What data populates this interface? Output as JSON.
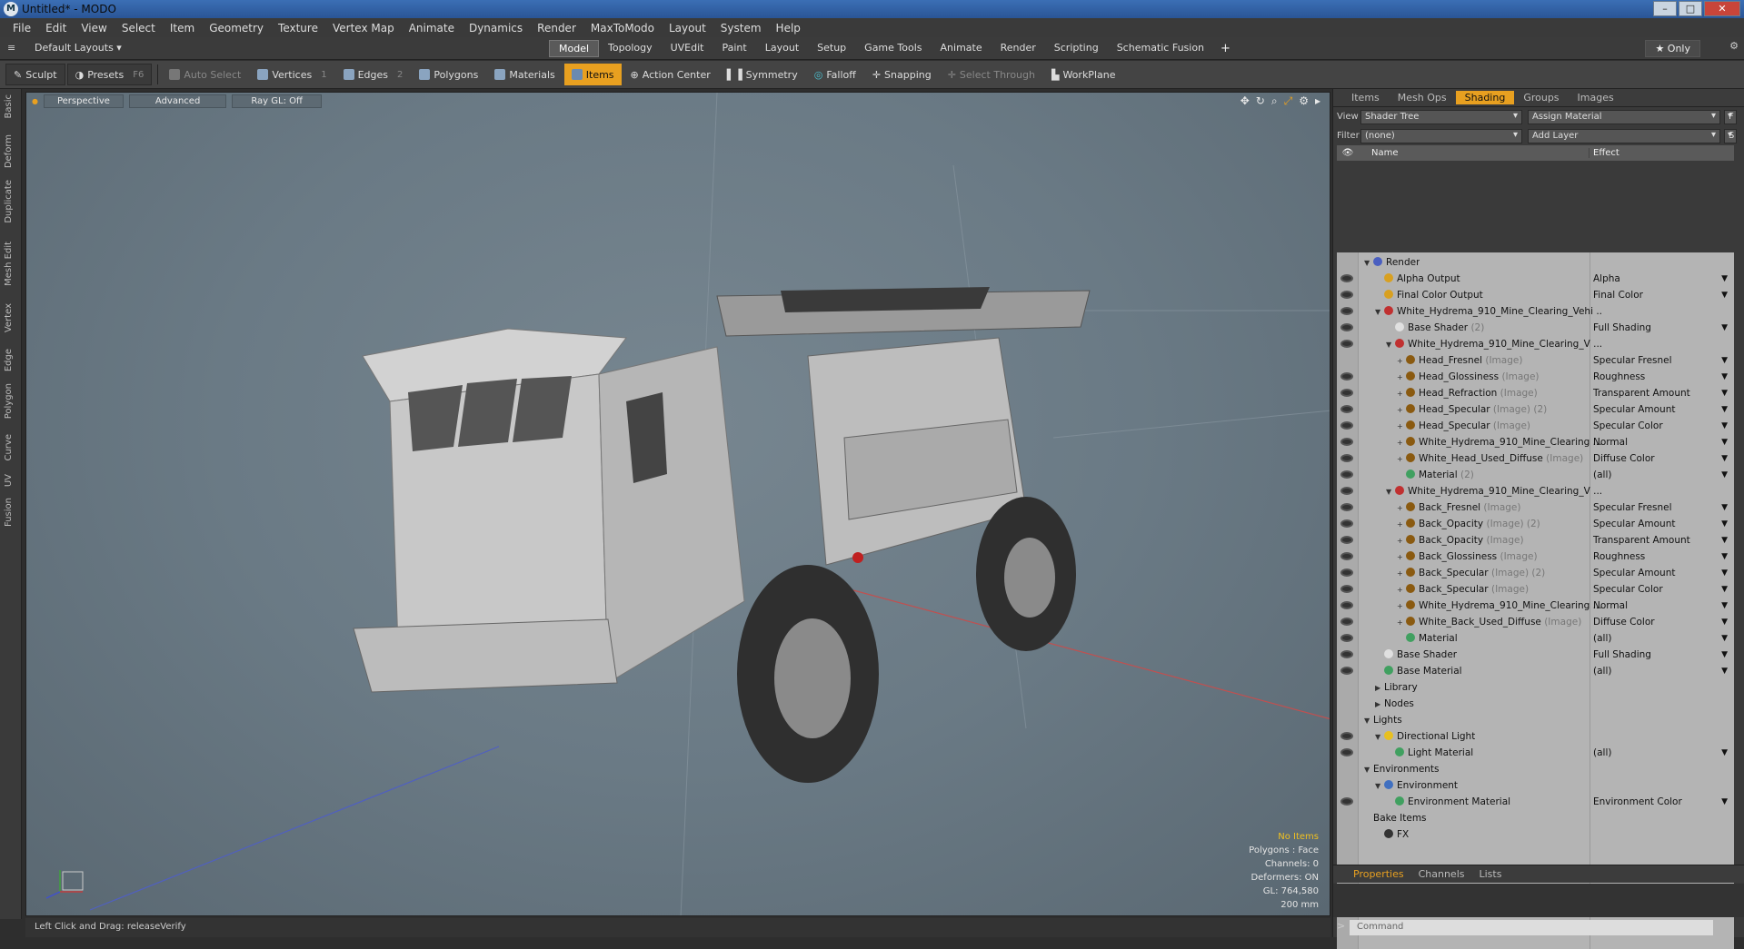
{
  "window": {
    "title": "Untitled* - MODO",
    "logo": "M"
  },
  "menu": [
    "File",
    "Edit",
    "View",
    "Select",
    "Item",
    "Geometry",
    "Texture",
    "Vertex Map",
    "Animate",
    "Dynamics",
    "Render",
    "MaxToModo",
    "Layout",
    "System",
    "Help"
  ],
  "layouts_label": "Default Layouts ▾",
  "tabs": [
    "Model",
    "Topology",
    "UVEdit",
    "Paint",
    "Layout",
    "Setup",
    "Game Tools",
    "Animate",
    "Render",
    "Scripting",
    "Schematic Fusion"
  ],
  "active_tab": "Model",
  "only_label": "★ Only",
  "toolbar": {
    "sculpt": "Sculpt",
    "presets": "Presets",
    "presets_key": "F6",
    "auto_select": "Auto Select",
    "vertices": "Vertices",
    "vertices_key": "1",
    "edges": "Edges",
    "edges_key": "2",
    "polygons": "Polygons",
    "materials": "Materials",
    "items": "Items",
    "action_center": "Action Center",
    "symmetry": "Symmetry",
    "falloff": "Falloff",
    "snapping": "Snapping",
    "select_through": "Select Through",
    "workplane": "WorkPlane"
  },
  "left_tabs": [
    "Basic",
    "Deform",
    "Duplicate",
    "Mesh Edit",
    "Vertex",
    "Edge",
    "Polygon",
    "Curve",
    "UV",
    "Fusion"
  ],
  "viewport": {
    "perspective": "Perspective",
    "advanced": "Advanced",
    "raygl": "Ray GL: Off",
    "stats": {
      "items": "No Items",
      "polygons": "Polygons : Face",
      "channels": "Channels: 0",
      "deformers": "Deformers: ON",
      "gl": "GL: 764,580",
      "scale": "200 mm"
    }
  },
  "status": "Left Click and Drag:  releaseVerify",
  "right_tabs": [
    "Items",
    "Mesh Ops",
    "Shading",
    "Groups",
    "Images"
  ],
  "active_right_tab": "Shading",
  "view_label": "View",
  "view_value": "Shader Tree",
  "assign_material": "Assign Material",
  "filter_label": "Filter",
  "filter_value": "(none)",
  "add_layer": "Add Layer",
  "tree_cols": {
    "name": "Name",
    "effect": "Effect"
  },
  "tree": [
    {
      "d": 0,
      "eye": false,
      "arr": "▼",
      "ico": "#4a5fc0",
      "name": "Render",
      "sub": "",
      "eff": ""
    },
    {
      "d": 1,
      "eye": true,
      "arr": "",
      "ico": "#d8a020",
      "name": "Alpha Output",
      "sub": "",
      "eff": "Alpha"
    },
    {
      "d": 1,
      "eye": true,
      "arr": "",
      "ico": "#d8a020",
      "name": "Final Color Output",
      "sub": "",
      "eff": "Final Color"
    },
    {
      "d": 1,
      "eye": true,
      "arr": "▼",
      "ico": "#c03030",
      "name": "White_Hydrema_910_Mine_Clearing_Vehi ...",
      "sub": "",
      "eff": ""
    },
    {
      "d": 2,
      "eye": true,
      "arr": "",
      "ico": "#e0e0e0",
      "name": "Base Shader",
      "sub": " (2)",
      "eff": "Full Shading"
    },
    {
      "d": 2,
      "eye": true,
      "arr": "▼",
      "ico": "#c03030",
      "name": "White_Hydrema_910_Mine_Clearing_V ...",
      "sub": "",
      "eff": ""
    },
    {
      "d": 3,
      "eye": false,
      "arr": "+",
      "ico": "#8a5a10",
      "name": "Head_Fresnel",
      "sub": " (Image)",
      "eff": "Specular Fresnel"
    },
    {
      "d": 3,
      "eye": true,
      "arr": "+",
      "ico": "#8a5a10",
      "name": "Head_Glossiness",
      "sub": " (Image)",
      "eff": "Roughness"
    },
    {
      "d": 3,
      "eye": true,
      "arr": "+",
      "ico": "#8a5a10",
      "name": "Head_Refraction",
      "sub": " (Image)",
      "eff": "Transparent Amount"
    },
    {
      "d": 3,
      "eye": true,
      "arr": "+",
      "ico": "#8a5a10",
      "name": "Head_Specular",
      "sub": " (Image) (2)",
      "eff": "Specular Amount"
    },
    {
      "d": 3,
      "eye": true,
      "arr": "+",
      "ico": "#8a5a10",
      "name": "Head_Specular",
      "sub": " (Image)",
      "eff": "Specular Color"
    },
    {
      "d": 3,
      "eye": true,
      "arr": "+",
      "ico": "#8a5a10",
      "name": "White_Hydrema_910_Mine_Clearing ...",
      "sub": "",
      "eff": "Normal"
    },
    {
      "d": 3,
      "eye": true,
      "arr": "+",
      "ico": "#8a5a10",
      "name": "White_Head_Used_Diffuse",
      "sub": " (Image)",
      "eff": "Diffuse Color"
    },
    {
      "d": 3,
      "eye": true,
      "arr": "",
      "ico": "#40a060",
      "name": "Material",
      "sub": " (2)",
      "eff": "(all)"
    },
    {
      "d": 2,
      "eye": true,
      "arr": "▼",
      "ico": "#c03030",
      "name": "White_Hydrema_910_Mine_Clearing_V ...",
      "sub": "",
      "eff": ""
    },
    {
      "d": 3,
      "eye": true,
      "arr": "+",
      "ico": "#8a5a10",
      "name": "Back_Fresnel",
      "sub": " (Image)",
      "eff": "Specular Fresnel"
    },
    {
      "d": 3,
      "eye": true,
      "arr": "+",
      "ico": "#8a5a10",
      "name": "Back_Opacity",
      "sub": " (Image) (2)",
      "eff": "Specular Amount"
    },
    {
      "d": 3,
      "eye": true,
      "arr": "+",
      "ico": "#8a5a10",
      "name": "Back_Opacity",
      "sub": " (Image)",
      "eff": "Transparent Amount"
    },
    {
      "d": 3,
      "eye": true,
      "arr": "+",
      "ico": "#8a5a10",
      "name": "Back_Glossiness",
      "sub": " (Image)",
      "eff": "Roughness"
    },
    {
      "d": 3,
      "eye": true,
      "arr": "+",
      "ico": "#8a5a10",
      "name": "Back_Specular",
      "sub": " (Image) (2)",
      "eff": "Specular Amount"
    },
    {
      "d": 3,
      "eye": true,
      "arr": "+",
      "ico": "#8a5a10",
      "name": "Back_Specular",
      "sub": " (Image)",
      "eff": "Specular Color"
    },
    {
      "d": 3,
      "eye": true,
      "arr": "+",
      "ico": "#8a5a10",
      "name": "White_Hydrema_910_Mine_Clearing ...",
      "sub": "",
      "eff": "Normal"
    },
    {
      "d": 3,
      "eye": true,
      "arr": "+",
      "ico": "#8a5a10",
      "name": "White_Back_Used_Diffuse",
      "sub": " (Image)",
      "eff": "Diffuse Color"
    },
    {
      "d": 3,
      "eye": true,
      "arr": "",
      "ico": "#40a060",
      "name": "Material",
      "sub": "",
      "eff": "(all)"
    },
    {
      "d": 1,
      "eye": true,
      "arr": "",
      "ico": "#e0e0e0",
      "name": "Base Shader",
      "sub": "",
      "eff": "Full Shading"
    },
    {
      "d": 1,
      "eye": true,
      "arr": "",
      "ico": "#40a060",
      "name": "Base Material",
      "sub": "",
      "eff": "(all)"
    },
    {
      "d": 1,
      "eye": false,
      "arr": "▶",
      "ico": "",
      "name": "Library",
      "sub": "",
      "eff": ""
    },
    {
      "d": 1,
      "eye": false,
      "arr": "▶",
      "ico": "",
      "name": "Nodes",
      "sub": "",
      "eff": ""
    },
    {
      "d": 0,
      "eye": false,
      "arr": "▼",
      "ico": "",
      "name": "Lights",
      "sub": "",
      "eff": ""
    },
    {
      "d": 1,
      "eye": true,
      "arr": "▼",
      "ico": "#e8c020",
      "name": "Directional Light",
      "sub": "",
      "eff": ""
    },
    {
      "d": 2,
      "eye": true,
      "arr": "",
      "ico": "#40a060",
      "name": "Light Material",
      "sub": "",
      "eff": "(all)"
    },
    {
      "d": 0,
      "eye": false,
      "arr": "▼",
      "ico": "",
      "name": "Environments",
      "sub": "",
      "eff": ""
    },
    {
      "d": 1,
      "eye": false,
      "arr": "▼",
      "ico": "#4070c0",
      "name": "Environment",
      "sub": "",
      "eff": ""
    },
    {
      "d": 2,
      "eye": true,
      "arr": "",
      "ico": "#40a060",
      "name": "Environment Material",
      "sub": "",
      "eff": "Environment Color"
    },
    {
      "d": 0,
      "eye": false,
      "arr": "",
      "ico": "",
      "name": "Bake Items",
      "sub": "",
      "eff": ""
    },
    {
      "d": 1,
      "eye": false,
      "arr": "",
      "ico": "#333",
      "name": "FX",
      "sub": "",
      "eff": ""
    }
  ],
  "props_tabs": [
    "Properties",
    "Channels",
    "Lists"
  ],
  "command_placeholder": "Command"
}
